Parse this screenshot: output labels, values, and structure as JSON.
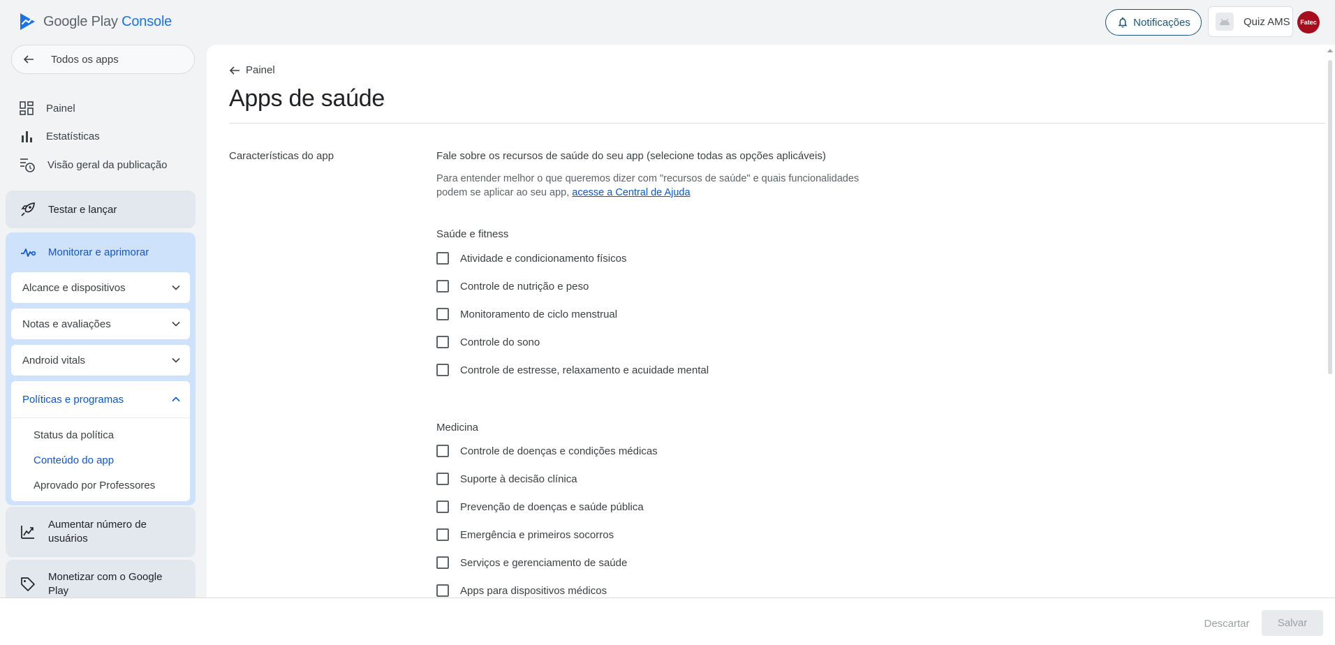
{
  "brand": {
    "google_play": "Google Play",
    "console": "Console",
    "accent": "#1a73e8"
  },
  "header": {
    "notifications_label": "Notificações",
    "app_name": "Quiz AMS",
    "avatar_text": "Fatec"
  },
  "sidebar": {
    "all_apps": "Todos os apps",
    "items": [
      {
        "label": "Painel",
        "icon": "dashboard-icon"
      },
      {
        "label": "Estatísticas",
        "icon": "bar-chart-icon"
      },
      {
        "label": "Visão geral da publicação",
        "icon": "publishing-overview-icon"
      }
    ],
    "sections": {
      "test_release": "Testar e lançar",
      "monitor": "Monitorar e aprimorar",
      "grow": "Aumentar número de usuários",
      "monetize": "Monetizar com o Google Play"
    },
    "monitor_subs": [
      {
        "label": "Alcance e dispositivos"
      },
      {
        "label": "Notas e avaliações"
      },
      {
        "label": "Android vitals"
      },
      {
        "label": "Políticas e programas"
      }
    ],
    "policy_links": [
      {
        "label": "Status da política"
      },
      {
        "label": "Conteúdo do app"
      },
      {
        "label": "Aprovado por Professores"
      }
    ],
    "active_color": "#0b57d0"
  },
  "main": {
    "back_label": "Painel",
    "title": "Apps de saúde",
    "row_label": "Características do app",
    "question": "Fale sobre os recursos de saúde do seu app (selecione todas as opções aplicáveis)",
    "description": "Para entender melhor o que queremos dizer com \"recursos de saúde\" e quais funcionalidades podem se aplicar ao seu app,",
    "help_link": "acesse a Central de Ajuda",
    "group1_title": "Saúde e fitness",
    "group1": [
      {
        "label": "Atividade e condicionamento físicos",
        "checked": false
      },
      {
        "label": "Controle de nutrição e peso",
        "checked": false
      },
      {
        "label": "Monitoramento de ciclo menstrual",
        "checked": false
      },
      {
        "label": "Controle do sono",
        "checked": false
      },
      {
        "label": "Controle de estresse, relaxamento e acuidade mental",
        "checked": false
      }
    ],
    "group2_title": "Medicina",
    "group2": [
      {
        "label": "Controle de doenças e condições médicas",
        "checked": false
      },
      {
        "label": "Suporte à decisão clínica",
        "checked": false
      },
      {
        "label": "Prevenção de doenças e saúde pública",
        "checked": false
      },
      {
        "label": "Emergência e primeiros socorros",
        "checked": false
      },
      {
        "label": "Serviços e gerenciamento de saúde",
        "checked": false
      },
      {
        "label": "Apps para dispositivos médicos",
        "checked": false
      }
    ]
  },
  "footer": {
    "discard": "Descartar",
    "save": "Salvar"
  }
}
